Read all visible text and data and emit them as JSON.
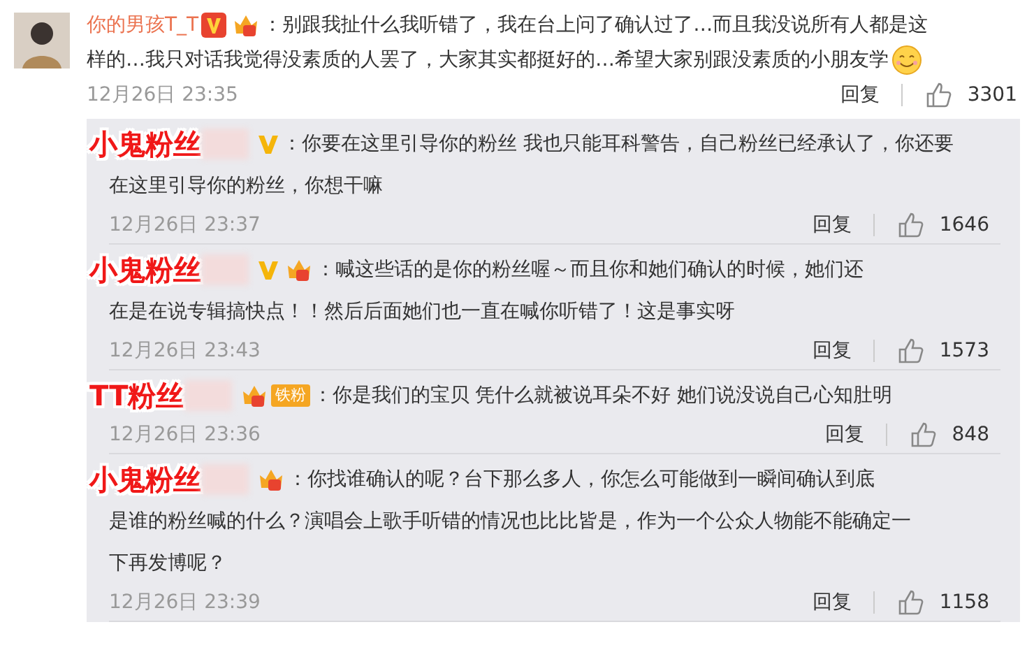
{
  "comment": {
    "author": "你的男孩T_T",
    "badges": [
      {
        "kind": "verified"
      },
      {
        "kind": "crown"
      }
    ],
    "lines": [
      "：别跟我扯什么我听错了，我在台上问了确认过了…而且我没说所有人都是这",
      "样的…我只对话我觉得没素质的人罢了，大家其实都挺好的…希望大家别跟没素质的小朋友学"
    ],
    "trailing_emoji": true,
    "time": "12月26日 23:35",
    "reply_label": "回复",
    "likes": "3301"
  },
  "replies": [
    {
      "label": "小鬼粉丝",
      "badges": [
        {
          "kind": "vip"
        }
      ],
      "lines": [
        "：你要在这里引导你的粉丝 我也只能耳科警告，自己粉丝已经承认了，你还要",
        "在这里引导你的粉丝，你想干嘛"
      ],
      "time": "12月26日 23:37",
      "reply_label": "回复",
      "likes": "1646"
    },
    {
      "label": "小鬼粉丝",
      "badges": [
        {
          "kind": "vip"
        },
        {
          "kind": "crown"
        }
      ],
      "lines": [
        "：喊这些话的是你的粉丝喔～而且你和她们确认的时候，她们还",
        "在是在说专辑搞快点！！然后后面她们也一直在喊你听错了！这是事实呀"
      ],
      "time": "12月26日 23:43",
      "reply_label": "回复",
      "likes": "1573"
    },
    {
      "label": "TT粉丝",
      "badges": [
        {
          "kind": "crown"
        },
        {
          "kind": "iron-fan",
          "text": "铁粉"
        }
      ],
      "lines": [
        "：你是我们的宝贝 凭什么就被说耳朵不好 她们说没说自己心知肚明"
      ],
      "time": "12月26日 23:36",
      "reply_label": "回复",
      "likes": "848"
    },
    {
      "label": "小鬼粉丝",
      "badges": [
        {
          "kind": "crown"
        }
      ],
      "lines": [
        "：你找谁确认的呢？台下那么多人，你怎么可能做到一瞬间确认到底",
        "是谁的粉丝喊的什么？演唱会上歌手听错的情况也比比皆是，作为一个公众人物能不能确定一",
        "下再发博呢？"
      ],
      "time": "12月26日 23:39",
      "reply_label": "回复",
      "likes": "1158"
    }
  ]
}
